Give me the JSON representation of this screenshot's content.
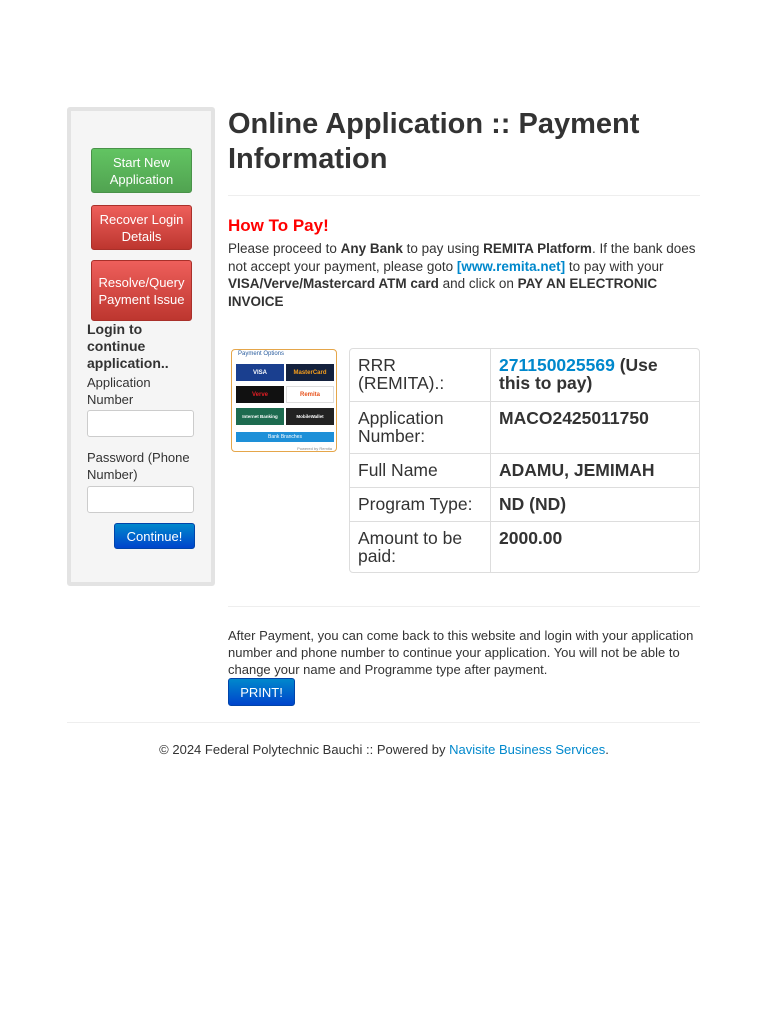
{
  "sidebar": {
    "start_new": "Start New Application",
    "recover": "Recover Login Details",
    "resolve": "Resolve/Query Payment Issue",
    "login_heading": "Login to continue application..",
    "app_number_label": "Application Number",
    "password_label": "Password (Phone Number)",
    "app_number_value": "",
    "password_value": "",
    "continue_label": "Continue!"
  },
  "main": {
    "title": "Online Application :: Payment Information",
    "how_heading": "How To Pay!",
    "how_text": {
      "p1": "Please proceed to ",
      "any_bank": "Any Bank",
      "p2": " to pay using ",
      "remita_platform": "REMITA Platform",
      "p3": ". If the bank does not accept your payment, please goto ",
      "remita_link": "[www.remita.net]",
      "p4": " to pay with your ",
      "cards": "VISA/Verve/Mastercard ATM card",
      "p5": " and click on ",
      "invoice": "PAY AN ELECTRONIC INVOICE"
    },
    "payment_options": {
      "title": "Payment Options",
      "cards": [
        "VISA",
        "MasterCard",
        "Verve",
        "Remita",
        "Internet Banking",
        "MobileWallet"
      ],
      "banks": "Bank Branches",
      "powered": "Powered by Remita"
    },
    "details": [
      {
        "label": "RRR (REMITA).:",
        "value": "271150025569",
        "note": " (Use this to pay)"
      },
      {
        "label": "Application Number:",
        "value": "MACO2425011750"
      },
      {
        "label": "Full Name",
        "value": "ADAMU, JEMIMAH"
      },
      {
        "label": "Program Type:",
        "value": "ND (ND)"
      },
      {
        "label": "Amount to be paid:",
        "value": "2000.00"
      }
    ],
    "after_text": "After Payment, you can come back to this website and login with your application number and phone number to continue your application. You will not be able to change your name and Programme type after payment.",
    "print_label": "PRINT!"
  },
  "footer": {
    "text": "© 2024 Federal Polytechnic Bauchi :: Powered by ",
    "link": "Navisite Business Services",
    "end": "."
  },
  "colors": {
    "link": "#0088cc",
    "heading_red": "#ff0000",
    "btn_green": "#51a351",
    "btn_red": "#bd362f",
    "btn_blue": "#0044cc"
  }
}
